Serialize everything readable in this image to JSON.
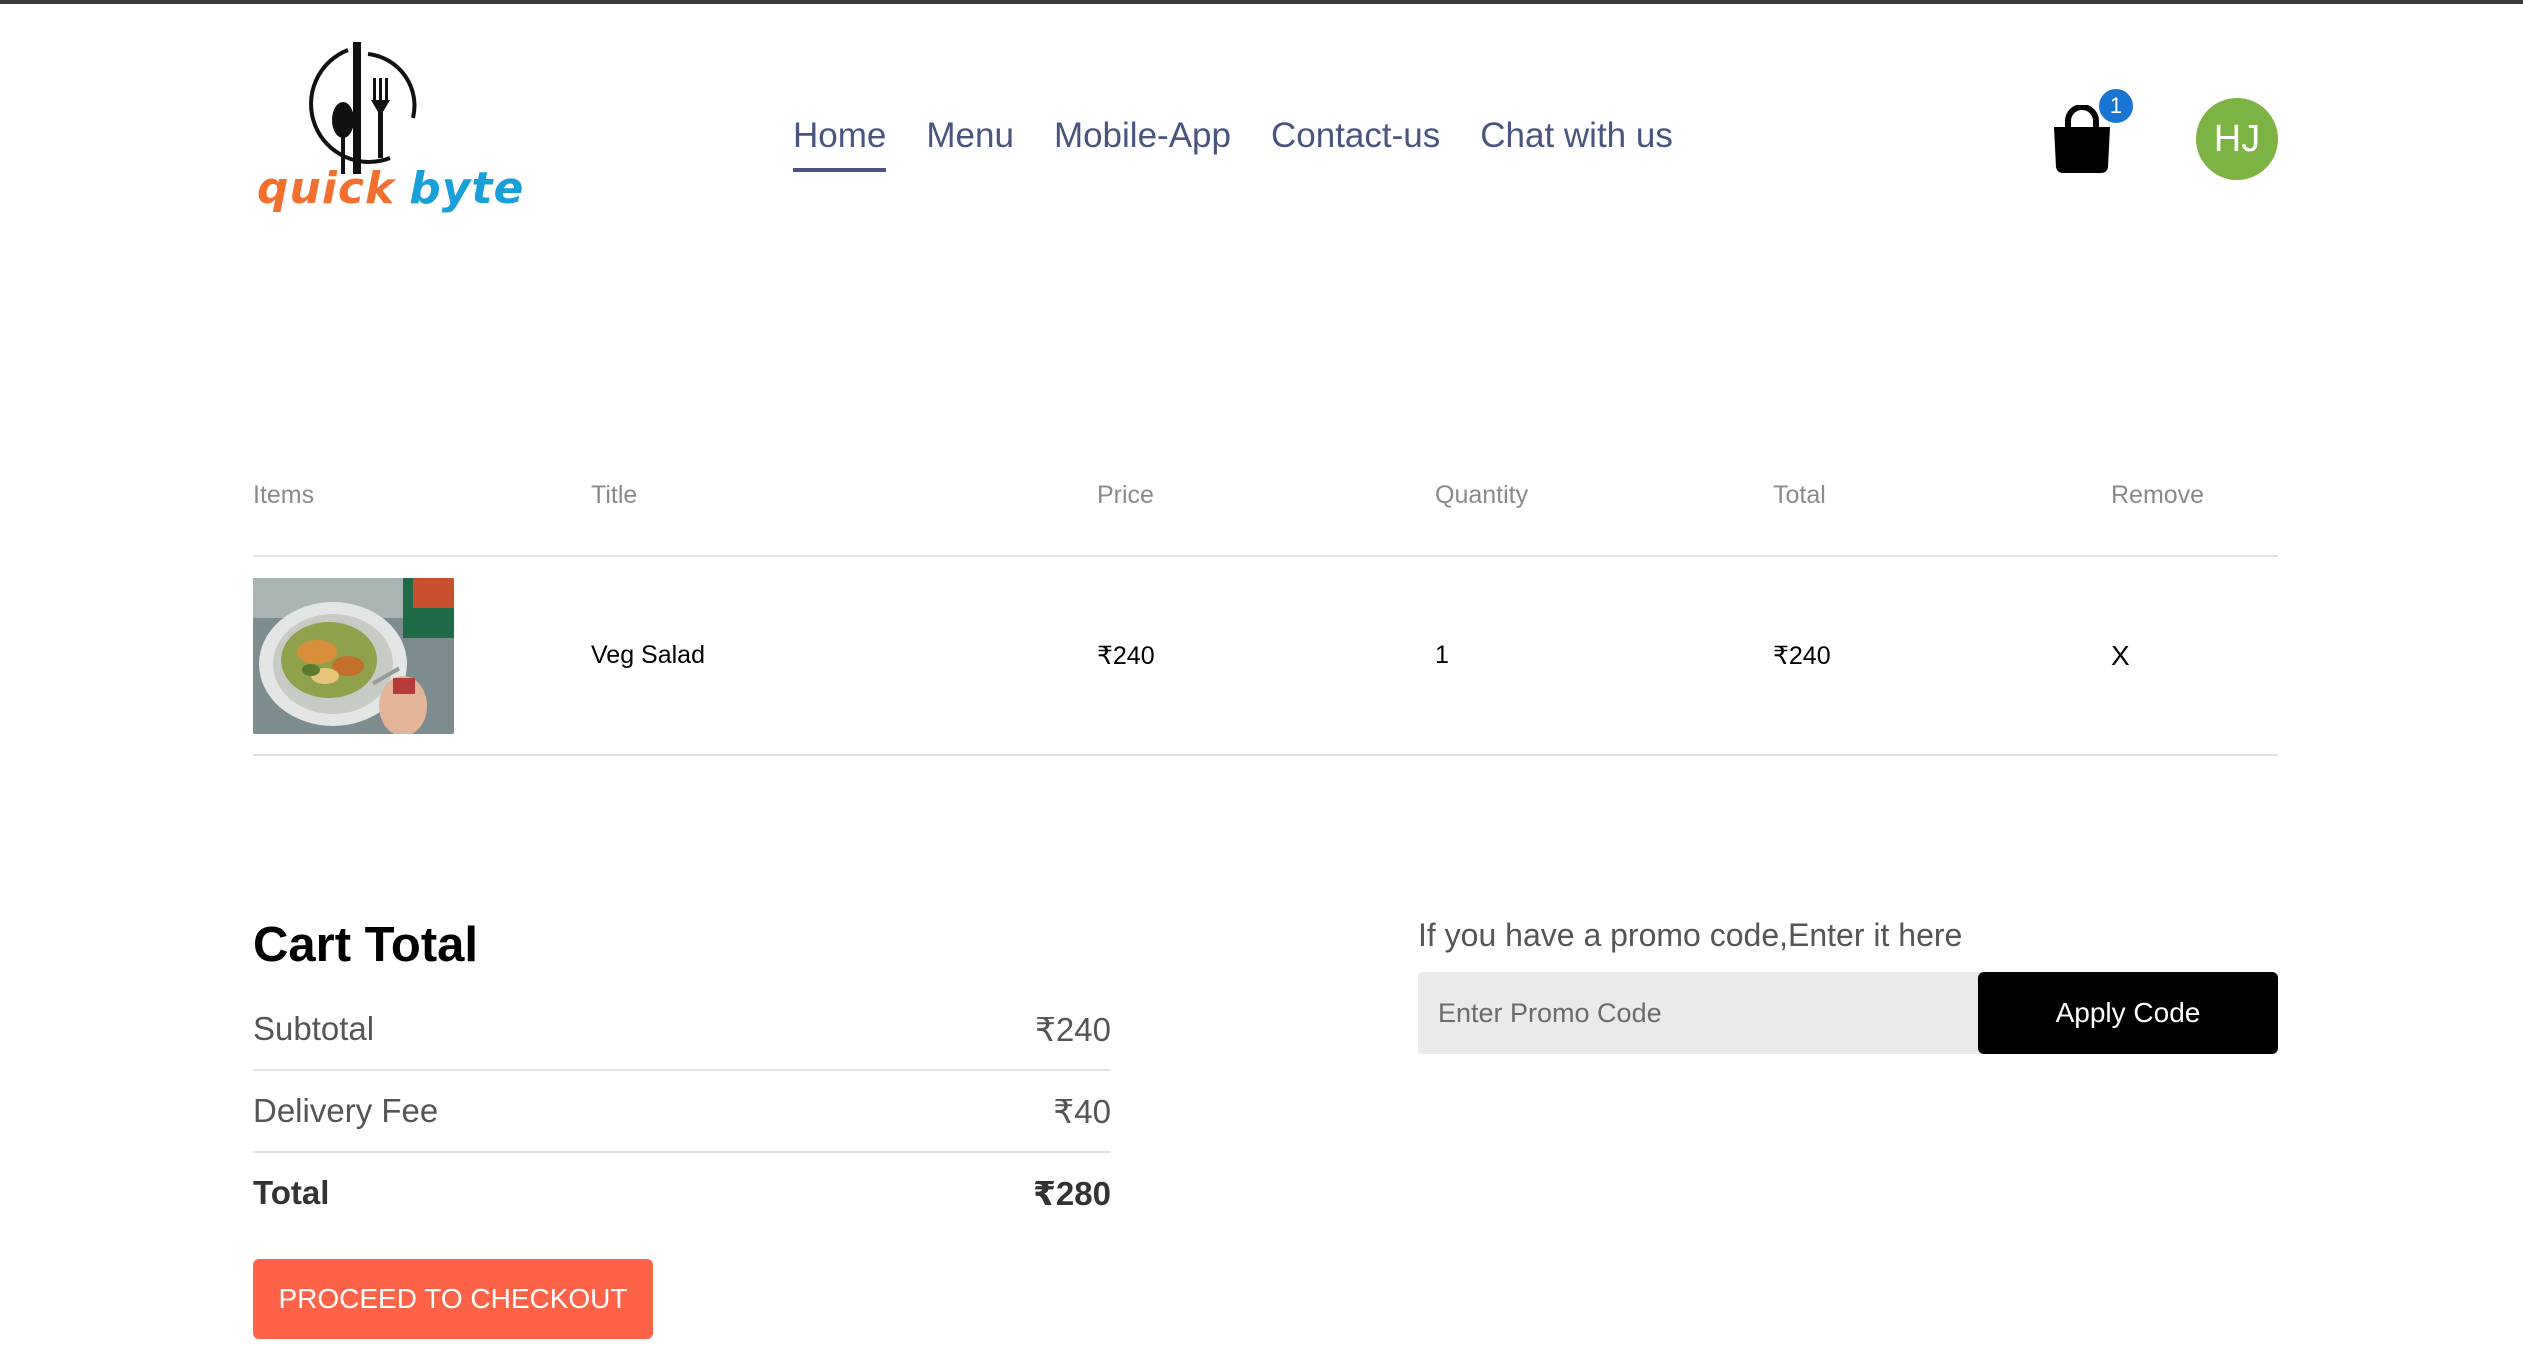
{
  "brand": {
    "word1": "quick",
    "word2": "byte"
  },
  "nav": {
    "items": [
      "Home",
      "Menu",
      "Mobile-App",
      "Contact-us",
      "Chat with us"
    ],
    "active": "Home"
  },
  "cart_icon": {
    "icon": "shopping-bag-icon",
    "count": "1"
  },
  "user": {
    "initials": "HJ",
    "avatar_color": "#7cb342"
  },
  "cart_table": {
    "headers": [
      "Items",
      "Title",
      "Price",
      "Quantity",
      "Total",
      "Remove"
    ],
    "rows": [
      {
        "image": "veg-salad-photo",
        "title": "Veg Salad",
        "price": "₹240",
        "quantity": "1",
        "total": "₹240",
        "remove": "X"
      }
    ]
  },
  "cart_total": {
    "heading": "Cart Total",
    "subtotal_label": "Subtotal",
    "subtotal_value": "₹240",
    "delivery_label": "Delivery Fee",
    "delivery_value": "₹40",
    "total_label": "Total",
    "total_value": "₹280",
    "checkout_label": "PROCEED TO CHECKOUT"
  },
  "promo": {
    "prompt": "If you have a promo code,Enter it here",
    "placeholder": "Enter Promo Code",
    "value": "",
    "apply_label": "Apply Code"
  },
  "colors": {
    "accent": "#ff6347",
    "nav_text": "#49557e",
    "badge": "#1a75d2",
    "apply_button": "#000000"
  }
}
